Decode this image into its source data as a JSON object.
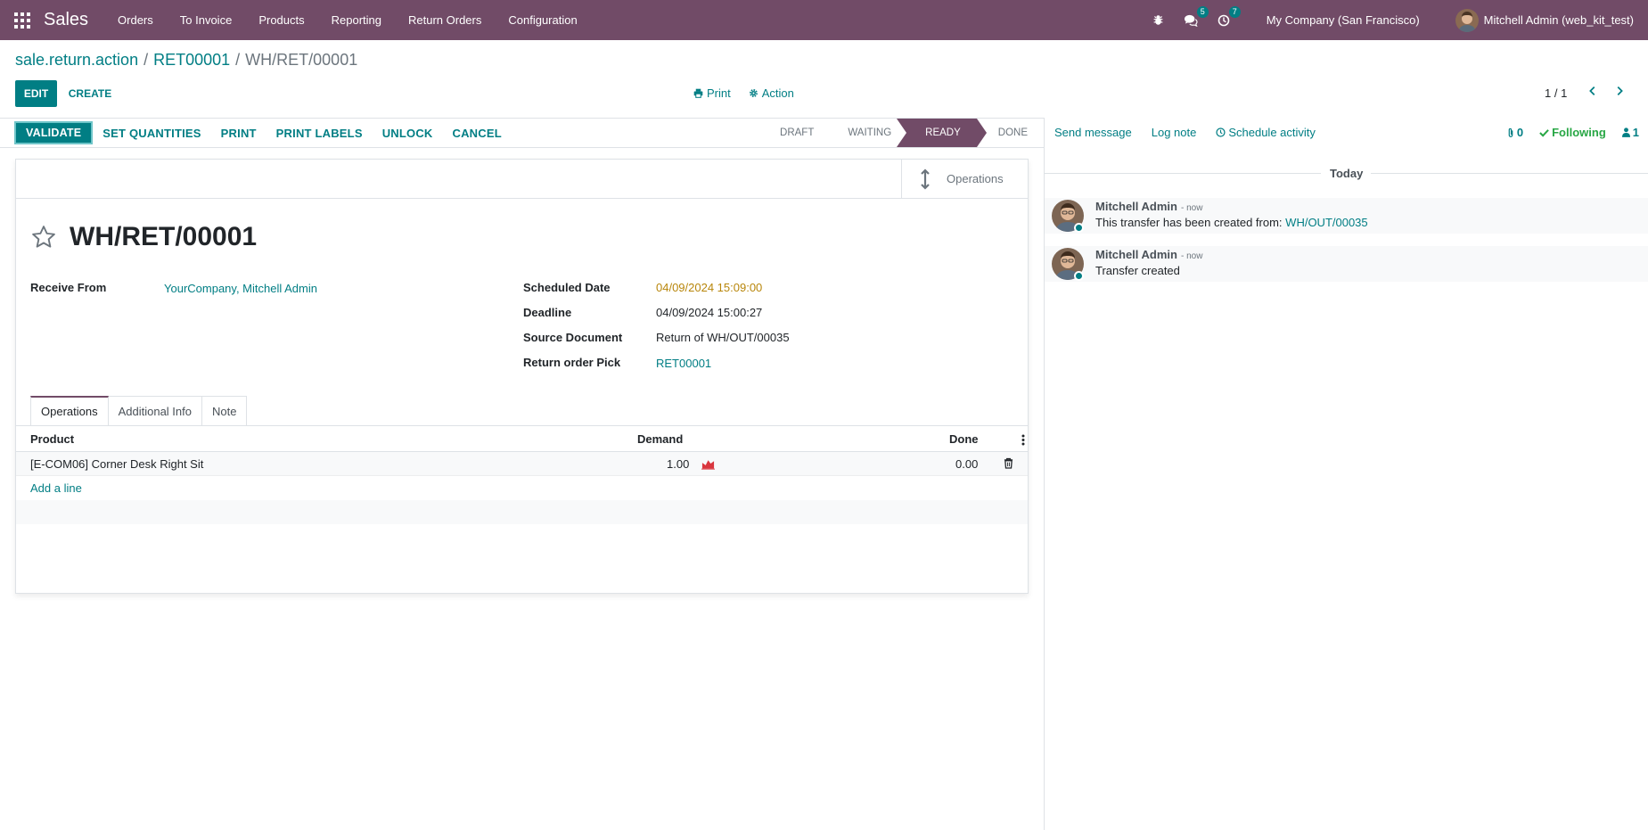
{
  "app": {
    "name": "Sales"
  },
  "menu": [
    "Orders",
    "To Invoice",
    "Products",
    "Reporting",
    "Return Orders",
    "Configuration"
  ],
  "systray": {
    "messages_count": "5",
    "activities_count": "7"
  },
  "company": "My Company (San Francisco)",
  "user": "Mitchell Admin (web_kit_test)",
  "breadcrumb": {
    "part1": "sale.return.action",
    "part2": "RET00001",
    "current": "WH/RET/00001"
  },
  "control": {
    "edit": "EDIT",
    "create": "CREATE",
    "print": "Print",
    "action": "Action",
    "pager": "1 / 1"
  },
  "statusbar": {
    "buttons": [
      "VALIDATE",
      "SET QUANTITIES",
      "PRINT",
      "PRINT LABELS",
      "UNLOCK",
      "CANCEL"
    ],
    "stages": [
      "DRAFT",
      "WAITING",
      "READY",
      "DONE"
    ],
    "active_stage": "READY"
  },
  "smart_button": "Operations",
  "record": {
    "name": "WH/RET/00001",
    "receive_from_label": "Receive From",
    "receive_from": "YourCompany, Mitchell Admin",
    "scheduled_date_label": "Scheduled Date",
    "scheduled_date": "04/09/2024 15:09:00",
    "deadline_label": "Deadline",
    "deadline": "04/09/2024 15:00:27",
    "source_document_label": "Source Document",
    "source_document": "Return of WH/OUT/00035",
    "return_pick_label": "Return order Pick",
    "return_pick": "RET00001"
  },
  "tabs": [
    "Operations",
    "Additional Info",
    "Note"
  ],
  "table": {
    "headers": {
      "product": "Product",
      "demand": "Demand",
      "done": "Done"
    },
    "rows": [
      {
        "product": "[E-COM06] Corner Desk Right Sit",
        "demand": "1.00",
        "done": "0.00"
      }
    ],
    "add_line": "Add a line"
  },
  "chatter": {
    "send_message": "Send message",
    "log_note": "Log note",
    "schedule_activity": "Schedule activity",
    "attachments": "0",
    "following": "Following",
    "followers": "1",
    "date_separator": "Today",
    "messages": [
      {
        "author": "Mitchell Admin",
        "time": "- now",
        "body": "This transfer has been created from:",
        "link": "WH/OUT/00035"
      },
      {
        "author": "Mitchell Admin",
        "time": "- now",
        "body": "Transfer created",
        "link": ""
      }
    ]
  },
  "colors": {
    "brand": "#714B67",
    "accent": "#017e84",
    "warning": "#b8860b"
  }
}
